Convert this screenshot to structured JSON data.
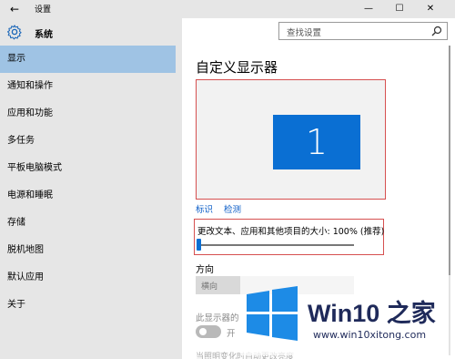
{
  "window": {
    "back_glyph": "←",
    "title": "设置",
    "minimize_glyph": "—",
    "maximize_glyph": "☐",
    "close_glyph": "✕"
  },
  "sidebar": {
    "app_name": "系统",
    "items": [
      {
        "label": "显示",
        "active": true
      },
      {
        "label": "通知和操作"
      },
      {
        "label": "应用和功能"
      },
      {
        "label": "多任务"
      },
      {
        "label": "平板电脑模式"
      },
      {
        "label": "电源和睡眠"
      },
      {
        "label": "存储"
      },
      {
        "label": "脱机地图"
      },
      {
        "label": "默认应用"
      },
      {
        "label": "关于"
      }
    ]
  },
  "search": {
    "placeholder": "查找设置"
  },
  "main": {
    "title": "自定义显示器",
    "monitor_number": "1",
    "identify_link": "标识",
    "detect_link": "检测",
    "scale_label": "更改文本、应用和其他项目的大小: 100% (推荐)",
    "scale_value_percent": 0,
    "orientation_label": "方向",
    "orientation_value": "横向",
    "lock_rotation_label": "此显示器的",
    "toggle_text": "开",
    "cut_text": "当照明变化时自动更改亮度"
  },
  "watermark": {
    "brand": "Win10 之家",
    "url": "www.win10xitong.com"
  },
  "colors": {
    "accent": "#0a6fd3",
    "sidebar_bg": "#e6e6e6",
    "active_item": "#9fc3e4",
    "highlight_border": "#d65050",
    "link": "#0a5cc7"
  }
}
